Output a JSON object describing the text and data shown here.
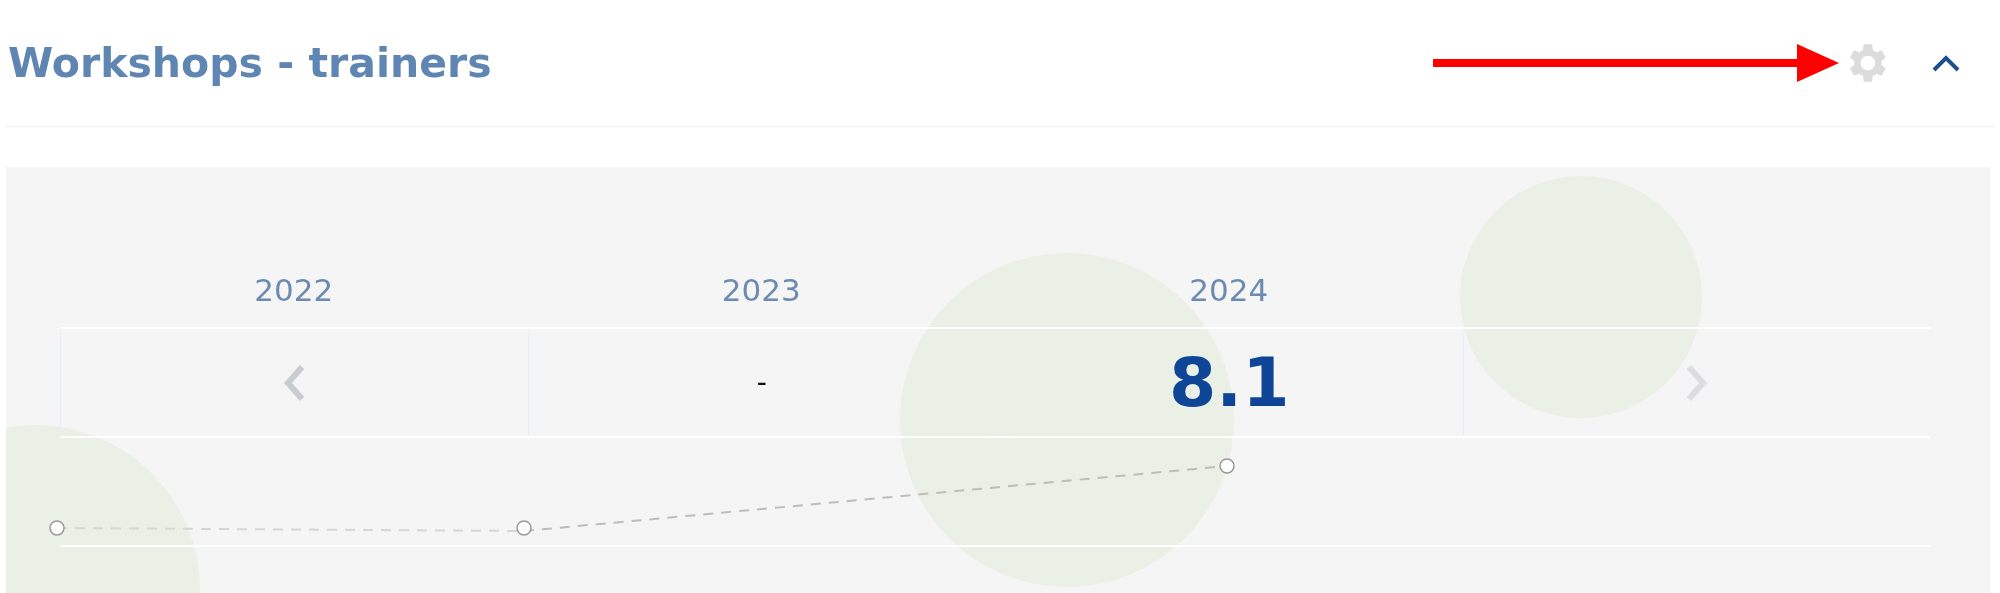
{
  "title": "Workshops - trainers",
  "header": {
    "expanded": true
  },
  "columns": [
    {
      "kind": "prev",
      "year": "2022"
    },
    {
      "kind": "dash",
      "year": "2023",
      "value": "-"
    },
    {
      "kind": "score",
      "year": "2024",
      "value": "8.1"
    },
    {
      "kind": "next"
    }
  ]
}
